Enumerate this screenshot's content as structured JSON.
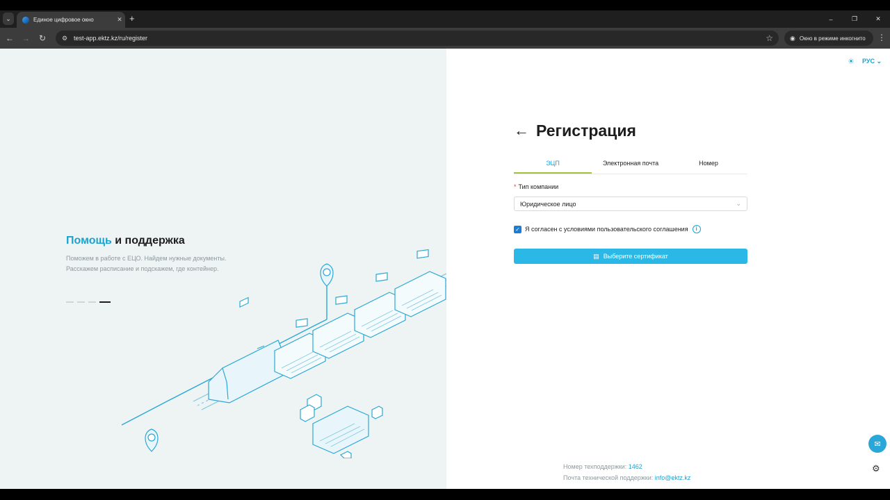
{
  "browser": {
    "tab_title": "Единое цифровое окно",
    "tab_close": "✕",
    "new_tab": "+",
    "url": "test-app.ektz.kz/ru/register",
    "incognito_label": "Окно в режиме инкогнито",
    "win_minimize": "–",
    "win_restore": "❐",
    "win_close": "✕"
  },
  "promo": {
    "title_accent": "Помощь",
    "title_rest": " и поддержка",
    "line1": "Поможем в работе с ЕЦО. Найдем нужные документы.",
    "line2": "Расскажем расписание и подскажем, где контейнер.",
    "slides_total": 4,
    "slide_active": 4
  },
  "header": {
    "language": "РУС",
    "theme_icon": "sun-icon"
  },
  "form": {
    "title": "Регистрация",
    "tabs": [
      "ЭЦП",
      "Электронная почта",
      "Номер"
    ],
    "active_tab": 0,
    "company_type_label": "Тип компании",
    "required_mark": "*",
    "company_type_value": "Юридическое лицо",
    "agreement_text": "Я согласен с условиями пользовательского соглашения",
    "agreement_checked": true,
    "certificate_button": "Выберите сертификат"
  },
  "support": {
    "phone_label": "Номер техподдержки:",
    "phone_value": "1462",
    "email_label": "Почта технической поддержки:",
    "email_value": "info@ektz.kz"
  },
  "colors": {
    "accent": "#1aa3cf",
    "button": "#2cb8e6",
    "tab_underline": "#a1c23c",
    "left_background": "#eef3f3"
  }
}
